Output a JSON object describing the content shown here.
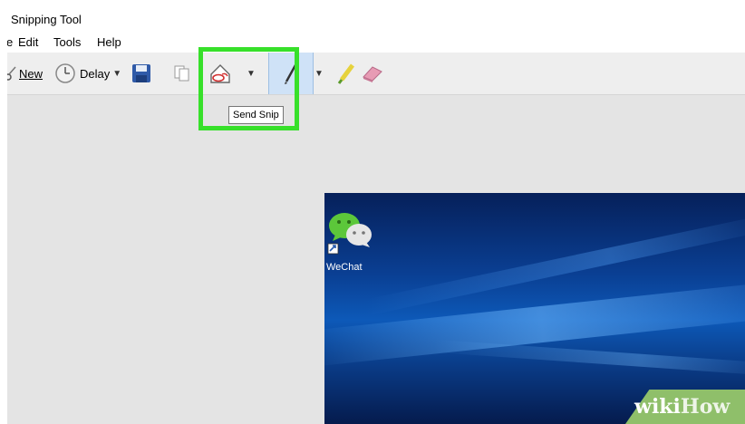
{
  "window": {
    "title": "Snipping Tool"
  },
  "menu": {
    "file_partial": "e",
    "items": [
      "Edit",
      "Tools",
      "Help"
    ]
  },
  "toolbar": {
    "new_label": "New",
    "delay_label": "Delay",
    "icons": [
      "scissors-icon",
      "clock-icon",
      "save-icon",
      "copy-icon",
      "send-snip-icon",
      "pen-icon",
      "highlighter-icon",
      "eraser-icon"
    ]
  },
  "tooltip": {
    "text": "Send Snip"
  },
  "desktop": {
    "shortcut_label": "WeChat"
  },
  "watermark": {
    "part1": "wiki",
    "part2": "How"
  },
  "colors": {
    "highlight": "#37e02a",
    "accent_pen": "#2a5db0",
    "wechat_green": "#5cc73a"
  }
}
